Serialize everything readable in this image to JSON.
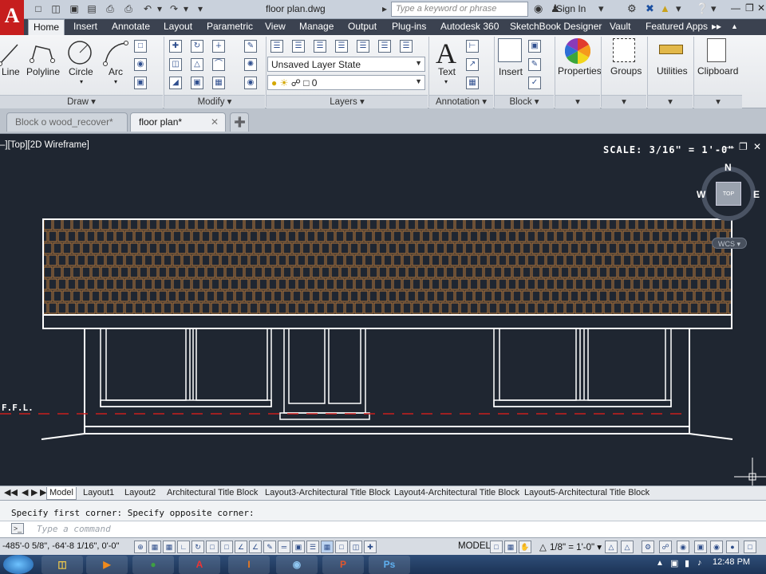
{
  "titlebar": {
    "doc_title": "floor plan.dwg",
    "search_placeholder": "Type a keyword or phrase",
    "sign_in": "Sign In",
    "logo": "A"
  },
  "tabs": [
    "Home",
    "Insert",
    "Annotate",
    "Layout",
    "Parametric",
    "View",
    "Manage",
    "Output",
    "Plug-ins",
    "Autodesk 360",
    "SketchBook Designer",
    "Vault",
    "Featured Apps"
  ],
  "ribbon": {
    "draw": {
      "title": "Draw",
      "line": "Line",
      "polyline": "Polyline",
      "circle": "Circle",
      "arc": "Arc"
    },
    "modify": {
      "title": "Modify"
    },
    "layers": {
      "title": "Layers",
      "layer_state": "Unsaved Layer State",
      "current_layer": "0"
    },
    "annotation": {
      "title": "Annotation",
      "text": "Text"
    },
    "block": {
      "title": "Block",
      "insert": "Insert"
    },
    "properties": "Properties",
    "groups": "Groups",
    "utilities": "Utilities",
    "clipboard": "Clipboard"
  },
  "doc_tabs": [
    {
      "label": "Block o wood_recover*"
    },
    {
      "label": "floor plan*"
    }
  ],
  "viewport": {
    "label": "–][Top][2D Wireframe]",
    "scale_text": "SCALE: 3/16\" = 1'-0\"",
    "ffl_label": "F.F.L.",
    "compass": {
      "n": "N",
      "s": "S",
      "e": "E",
      "w": "W",
      "top": "TOP"
    },
    "wcs": "WCS"
  },
  "layout_tabs": [
    "Model",
    "Layout1",
    "Layout2",
    "Architectural Title Block",
    "Layout3-Architectural Title Block",
    "Layout4-Architectural Title Block",
    "Layout5-Architectural Title Block"
  ],
  "command": {
    "history": "Specify first corner: Specify opposite corner:",
    "placeholder": "Type a command"
  },
  "statusbar": {
    "coords": "-485'-0 5/8\", -64'-8 1/16\", 0'-0\"",
    "model": "MODEL",
    "annotation_scale": "1/8\" = 1'-0\""
  },
  "taskbar": {
    "time": "12:48 PM"
  }
}
